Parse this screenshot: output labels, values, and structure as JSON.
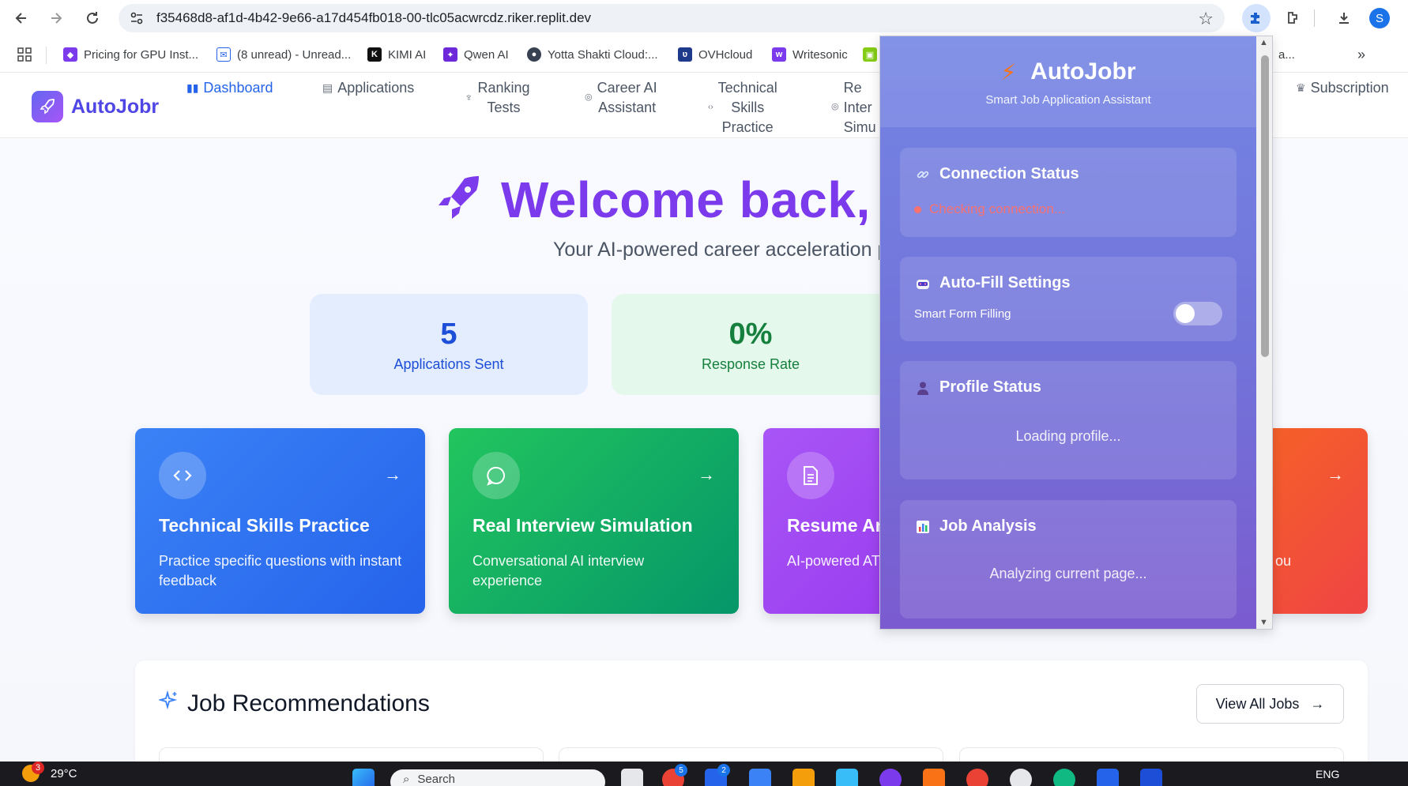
{
  "browser": {
    "url": "f35468d8-af1d-4b42-9e66-a17d454fb018-00-tlc05acwrcdz.riker.replit.dev",
    "profile_initial": "S",
    "bookmarks": [
      {
        "label": "Pricing for GPU Inst...",
        "icon": "cube-icon",
        "color": "#7c3aed"
      },
      {
        "label": "(8 unread) - Unread...",
        "icon": "mail-icon",
        "color": "#2563eb"
      },
      {
        "label": "KIMI AI",
        "icon": "kimi-icon",
        "color": "#111111"
      },
      {
        "label": "Qwen AI",
        "icon": "qwen-icon",
        "color": "#6d28d9"
      },
      {
        "label": "Yotta Shakti Cloud:...",
        "icon": "globe-icon",
        "color": "#374151"
      },
      {
        "label": "OVHcloud",
        "icon": "ovh-icon",
        "color": "#1e3a8a"
      },
      {
        "label": "Writesonic",
        "icon": "writesonic-icon",
        "color": "#7c3aed"
      }
    ],
    "bookmark_overflow_tail": "a..."
  },
  "header": {
    "brand": "AutoJobr",
    "nav": [
      {
        "label": "Dashboard",
        "icon": "bar-chart-icon",
        "active": true
      },
      {
        "label": "Applications",
        "icon": "document-icon",
        "active": false
      },
      {
        "label": "Ranking\nTests",
        "icon": "trophy-icon",
        "active": false
      },
      {
        "label": "Career AI\nAssistant",
        "icon": "brain-icon",
        "active": false
      },
      {
        "label": "Technical\nSkills\nPractice",
        "icon": "code-icon",
        "active": false
      },
      {
        "label": "Re\nInter\nSimu",
        "icon": "brain-icon",
        "active": false
      },
      {
        "label": "Subscription",
        "icon": "crown-icon",
        "active": false
      }
    ]
  },
  "main": {
    "welcome": "Welcome back, s",
    "subtitle": "Your AI-powered career acceleration p",
    "stats": [
      {
        "value": "5",
        "label": "Applications Sent"
      },
      {
        "value": "0%",
        "label": "Response Rate"
      }
    ],
    "features": [
      {
        "title": "Technical Skills Practice",
        "desc": "Practice specific questions with instant feedback",
        "icon": "code-icon"
      },
      {
        "title": "Real Interview Simulation",
        "desc": "Conversational AI interview experience",
        "icon": "chat-icon"
      },
      {
        "title": "Resume An",
        "desc": "AI-powered ATS",
        "icon": "file-text-icon"
      },
      {
        "title": "",
        "desc": "ou",
        "icon": ""
      }
    ],
    "jobs_title": "Job Recommendations",
    "view_all": "View All Jobs"
  },
  "popup": {
    "brand": "AutoJobr",
    "subtitle": "Smart Job Application Assistant",
    "connection": {
      "title": "Connection Status",
      "status": "Checking connection..."
    },
    "autofill": {
      "title": "Auto-Fill Settings",
      "toggle_label": "Smart Form Filling",
      "enabled": false
    },
    "profile": {
      "title": "Profile Status",
      "message": "Loading profile..."
    },
    "job": {
      "title": "Job Analysis",
      "message": "Analyzing current page..."
    }
  },
  "taskbar": {
    "temperature": "29°C",
    "weather_badge": "3",
    "search_placeholder": "Search",
    "language": "ENG",
    "app_badge_1": "5",
    "app_badge_2": "2"
  }
}
